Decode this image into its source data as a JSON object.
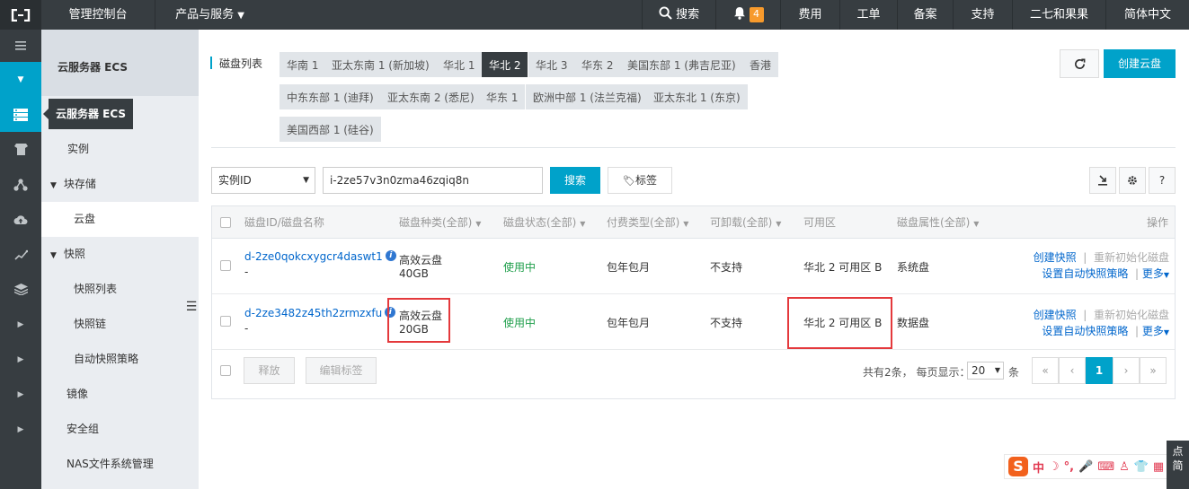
{
  "topbar": {
    "console": "管理控制台",
    "products": "产品与服务",
    "search": "搜索",
    "notifications_count": "4",
    "fees": "费用",
    "tickets": "工单",
    "icp": "备案",
    "support": "支持",
    "user": "二七和果果",
    "language": "简体中文"
  },
  "sidebar": {
    "title": "云服务器 ECS",
    "tooltip": "云服务器 ECS",
    "items": [
      {
        "label": "实例"
      },
      {
        "label": "块存储"
      },
      {
        "label": "云盘"
      },
      {
        "label": "快照"
      },
      {
        "label": "快照列表"
      },
      {
        "label": "快照链"
      },
      {
        "label": "自动快照策略"
      },
      {
        "label": "镜像"
      },
      {
        "label": "安全组"
      },
      {
        "label": "NAS文件系统管理"
      }
    ]
  },
  "regions": {
    "label": "磁盘列表",
    "items": [
      "华南 1",
      "亚太东南 1 (新加坡)",
      "华北 1",
      "华北 2",
      "华北 3",
      "华东 2",
      "美国东部 1 (弗吉尼亚)",
      "香港",
      "中东东部 1 (迪拜)",
      "亚太东南 2 (悉尼)",
      "华东 1",
      "欧洲中部 1 (法兰克福)",
      "亚太东北 1 (东京)",
      "美国西部 1 (硅谷)"
    ],
    "selected": "华北 2"
  },
  "toolbar": {
    "create_button": "创建云盘",
    "filter_select": "实例ID",
    "search_value": "i-2ze57v3n0zma46zqiq8n",
    "search_button": "搜索",
    "tag_button": "标签"
  },
  "table": {
    "headers": {
      "disk_id": "磁盘ID/磁盘名称",
      "disk_type": "磁盘种类(全部)",
      "disk_status": "磁盘状态(全部)",
      "billing": "付费类型(全部)",
      "detachable": "可卸载(全部)",
      "zone": "可用区",
      "attribute": "磁盘属性(全部)",
      "actions": "操作"
    },
    "rows": [
      {
        "id": "d-2ze0qokcxygcr4daswt1",
        "name": "-",
        "type": "高效云盘",
        "size": "40GB",
        "status": "使用中",
        "billing": "包年包月",
        "detachable": "不支持",
        "zone": "华北 2 可用区 B",
        "attribute": "系统盘",
        "action_snapshot": "创建快照",
        "action_reinit": "重新初始化磁盘",
        "action_policy": "设置自动快照策略",
        "action_more": "更多"
      },
      {
        "id": "d-2ze3482z45th2zrmzxfu",
        "name": "-",
        "type": "高效云盘",
        "size": "20GB",
        "status": "使用中",
        "billing": "包年包月",
        "detachable": "不支持",
        "zone": "华北 2 可用区 B",
        "attribute": "数据盘",
        "action_snapshot": "创建快照",
        "action_reinit": "重新初始化磁盘",
        "action_policy": "设置自动快照策略",
        "action_more": "更多"
      }
    ]
  },
  "footer": {
    "release": "释放",
    "edit_tags": "编辑标签",
    "total": "共有2条，",
    "per_page_label": "每页显示：",
    "per_page": "20",
    "per_page_unit": "条",
    "first": "«",
    "prev": "‹",
    "page": "1",
    "next": "›",
    "last": "»"
  },
  "ime": {
    "lang": "中"
  },
  "side_float": {
    "text1": "点",
    "text2": "简"
  },
  "colors": {
    "accent": "#00a2ca",
    "dark": "#373d41",
    "highlight": "#e4393c",
    "status_green": "#1e9e4a"
  }
}
